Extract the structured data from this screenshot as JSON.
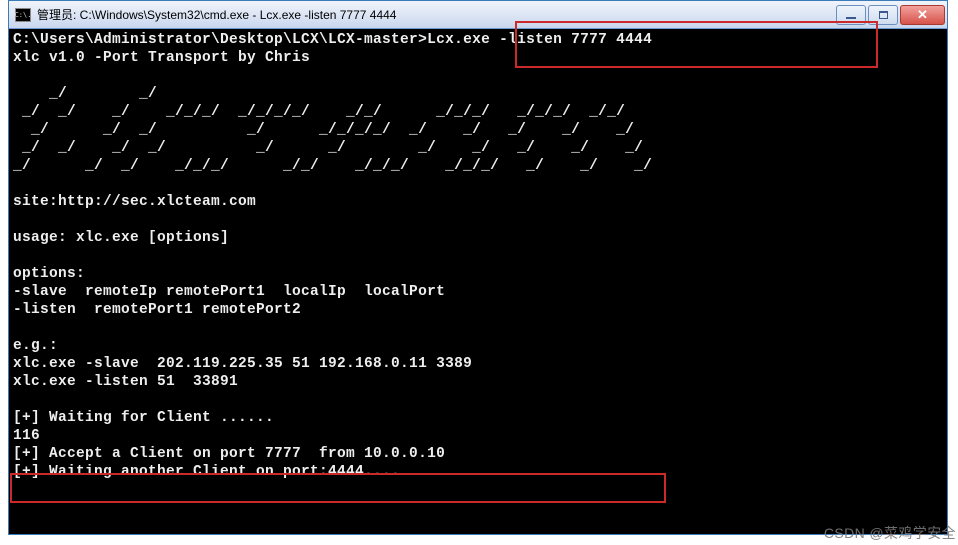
{
  "titlebar": {
    "icon_text": "C:\\.",
    "prefix": "管理员: ",
    "path": "C:\\Windows\\System32\\cmd.exe",
    "suffix": " - Lcx.exe  -listen 7777 4444"
  },
  "controls": {
    "minimize": "minimize",
    "maximize": "maximize",
    "close": "close"
  },
  "terminal": {
    "prompt": "C:\\Users\\Administrator\\Desktop\\LCX\\LCX-master>",
    "command": "Lcx.exe -listen 7777 4444",
    "version": "xlc v1.0 -Port Transport by Chris",
    "ascii1": "    _/        _/                                       ",
    "ascii2": " _/  _/    _/    _/_/_/  _/_/_/_/    _/_/      _/_/_/   _/_/_/  _/_/  ",
    "ascii3": "  _/      _/  _/          _/      _/_/_/_/  _/    _/   _/    _/    _/ ",
    "ascii4": " _/  _/    _/  _/          _/      _/        _/    _/   _/    _/    _/  ",
    "ascii5": "_/      _/  _/    _/_/_/      _/_/    _/_/_/    _/_/_/   _/    _/    _/   ",
    "site": "site:http://sec.xlcteam.com",
    "usage": "usage: xlc.exe [options]",
    "opts_label": "options:",
    "opt_slave": "-slave  remoteIp remotePort1  localIp  localPort",
    "opt_listen": "-listen  remotePort1 remotePort2",
    "eg_label": "e.g.:",
    "eg1": "xlc.exe -slave  202.119.225.35 51 192.168.0.11 3389",
    "eg2": "xlc.exe -listen 51  33891",
    "log_wait": "[+] Waiting for Client ......",
    "log_num": "116",
    "log_accept": "[+] Accept a Client on port 7777  from 10.0.0.10",
    "log_wait2": "[+] Waiting another Client on port:4444...."
  },
  "watermark": "CSDN @菜鸡学安全"
}
